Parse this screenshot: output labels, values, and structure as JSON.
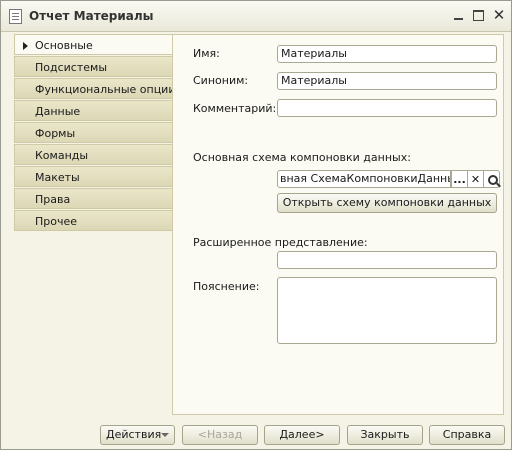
{
  "window": {
    "title": "Отчет Материалы"
  },
  "nav": {
    "items": [
      {
        "label": "Основные"
      },
      {
        "label": "Подсистемы"
      },
      {
        "label": "Функциональные опции"
      },
      {
        "label": "Данные"
      },
      {
        "label": "Формы"
      },
      {
        "label": "Команды"
      },
      {
        "label": "Макеты"
      },
      {
        "label": "Права"
      },
      {
        "label": "Прочее"
      }
    ],
    "active_index": 0
  },
  "form": {
    "name_label": "Имя:",
    "name_value": "Материалы",
    "synonym_label": "Синоним:",
    "synonym_value": "Материалы",
    "comment_label": "Комментарий:",
    "comment_value": "",
    "schema_label": "Основная схема компоновки данных:",
    "schema_value": "вная СхемаКомпоновкиДанных",
    "schema_select_label": "...",
    "schema_clear_label": "✕",
    "open_schema_label": "Открыть схему компоновки данных",
    "extended_repr_label": "Расширенное представление:",
    "extended_repr_value": "",
    "explanation_label": "Пояснение:",
    "explanation_value": ""
  },
  "footer": {
    "actions_label": "Действия",
    "back_label": "<Назад",
    "next_label": "Далее>",
    "close_label": "Закрыть",
    "help_label": "Справка"
  },
  "icons": [
    "document-icon",
    "minimize-icon",
    "maximize-icon",
    "close-icon",
    "arrow-right-icon",
    "search-icon",
    "clear-icon",
    "chevron-down-icon"
  ]
}
